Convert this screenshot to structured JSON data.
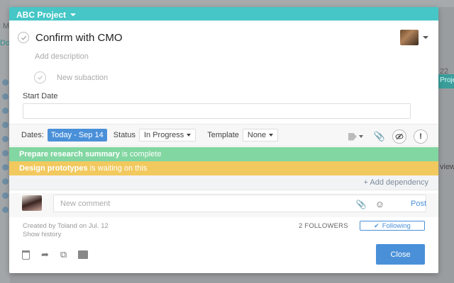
{
  "background": {
    "fragments": [
      "M",
      "Do",
      "22",
      "Projec",
      "view"
    ]
  },
  "modal": {
    "project_name": "ABC Project",
    "task_title": "Confirm with CMO",
    "description_placeholder": "Add description",
    "subaction_placeholder": "New subaction",
    "start_date_label": "Start Date",
    "start_date_value": ""
  },
  "meta": {
    "dates_label": "Dates:",
    "dates_value": "Today - Sep 14",
    "status_label": "Status",
    "status_value": "In Progress",
    "template_label": "Template",
    "template_value": "None"
  },
  "dependencies": {
    "complete": {
      "name": "Prepare research summary",
      "suffix": " is complete"
    },
    "waiting": {
      "name": "Design prototypes",
      "suffix": " is waiting on this"
    },
    "add_label": "+ Add dependency"
  },
  "comment": {
    "placeholder": "New comment",
    "post_label": "Post"
  },
  "footer": {
    "created_text": "Created by Toland on Jul. 12",
    "show_history": "Show history",
    "followers": "2 FOLLOWERS",
    "following_label": "Following",
    "close_label": "Close"
  },
  "colors": {
    "header": "#46c6c6",
    "accent_blue": "#4a90d9",
    "complete_green": "#82d6a1",
    "waiting_yellow": "#f2c95e"
  },
  "icons": [
    "check-icon",
    "tag-icon",
    "paperclip-icon",
    "eye-icon",
    "exclamation-icon",
    "smiley-icon",
    "trash-icon",
    "share-icon",
    "duplicate-icon",
    "archive-icon"
  ]
}
